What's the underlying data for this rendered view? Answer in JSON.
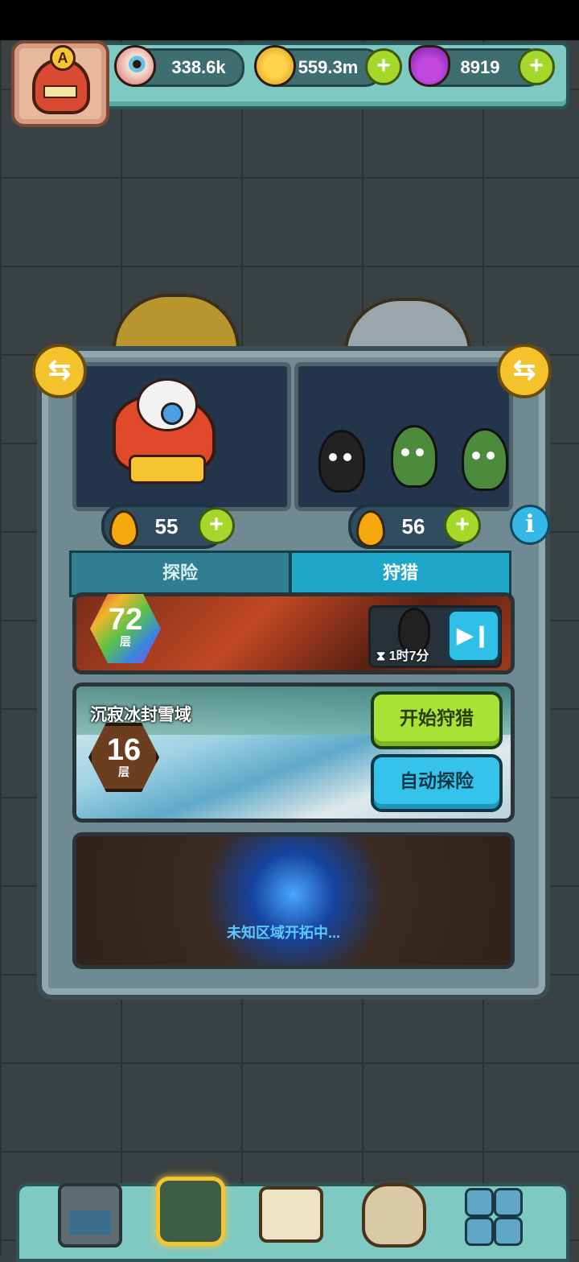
{
  "resources": {
    "eyeball": {
      "value": "338.6k",
      "icon": "eyeball-icon"
    },
    "coins": {
      "value": "559.3m",
      "icon": "coin-icon"
    },
    "potion": {
      "value": "8919",
      "icon": "potion-icon"
    }
  },
  "avatar": {
    "rank": "A"
  },
  "teams": {
    "left": {
      "energy": "55"
    },
    "right": {
      "energy": "56"
    }
  },
  "tabs": {
    "explore": "探险",
    "hunt": "狩猎"
  },
  "dungeons": {
    "volcano": {
      "floor": "72",
      "floor_unit": "层",
      "timer": "1时7分"
    },
    "ice": {
      "name": "沉寂冰封雪域",
      "floor": "16",
      "floor_unit": "层"
    },
    "unknown": {
      "text": "未知区域开拓中..."
    }
  },
  "buttons": {
    "start_hunt": "开始狩猎",
    "auto_explore": "自动探险"
  },
  "colors": {
    "accent_green": "#a8e234",
    "accent_blue": "#35c3ec",
    "gold": "#f4c22b"
  }
}
